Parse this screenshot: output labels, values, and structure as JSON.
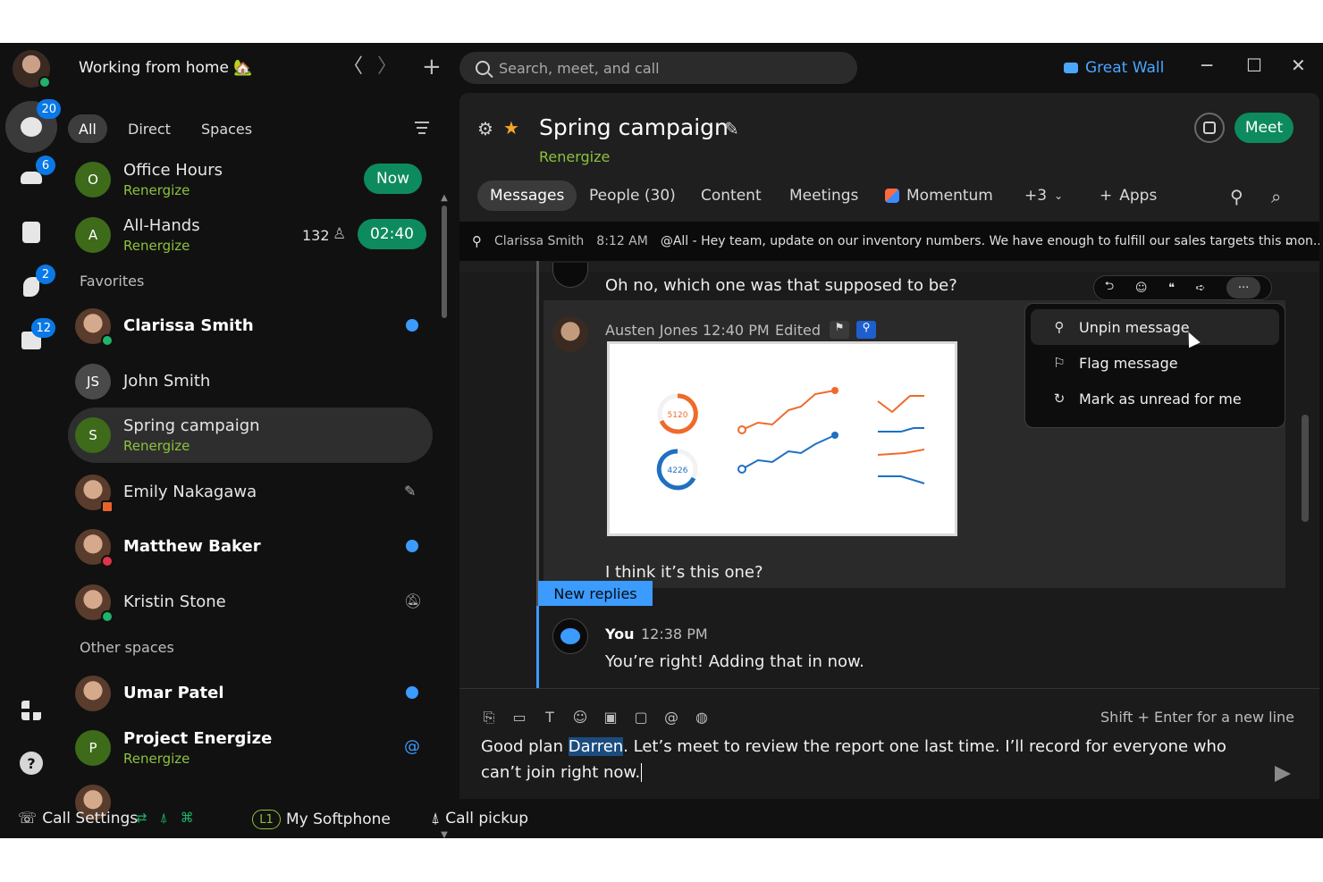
{
  "titlebar": {
    "status": "Working from home 🏡",
    "search_placeholder": "Search, meet, and call",
    "org_name": "Great Wall",
    "nav_back": "〈",
    "nav_forward": "〉",
    "new": "+",
    "minimize": "─",
    "maximize": "☐",
    "close": "✕"
  },
  "rail": {
    "messages_badge": "20",
    "teams_badge": "6",
    "calls_badge": "2",
    "calendar_badge": "12",
    "help": "?"
  },
  "filters": [
    "All",
    "Direct",
    "Spaces"
  ],
  "conversations": {
    "office_hours": {
      "initial": "O",
      "title": "Office Hours",
      "sub": "Renergize",
      "pill": "Now"
    },
    "all_hands": {
      "initial": "A",
      "title": "All-Hands",
      "sub": "Renergize",
      "count": "132",
      "pill": "02:40"
    },
    "favorites_label": "Favorites",
    "clarissa": {
      "title": "Clarissa Smith"
    },
    "john": {
      "initial": "JS",
      "title": "John Smith"
    },
    "spring": {
      "initial": "S",
      "title": "Spring campaign",
      "sub": "Renergize"
    },
    "emily": {
      "title": "Emily Nakagawa"
    },
    "matthew": {
      "title": "Matthew Baker"
    },
    "kristin": {
      "title": "Kristin Stone"
    },
    "other_label": "Other spaces",
    "umar": {
      "title": "Umar Patel"
    },
    "project": {
      "initial": "P",
      "title": "Project Energize",
      "sub": "Renergize"
    }
  },
  "space": {
    "title": "Spring campaign",
    "team": "Renergize",
    "meet_label": "Meet",
    "tabs": [
      "Messages",
      "People (30)",
      "Content",
      "Meetings",
      "Momentum",
      "+3",
      "Apps"
    ]
  },
  "pinned": {
    "author": "Clarissa Smith",
    "time": "8:12 AM",
    "text": "@All - Hey team, update on our inventory numbers. We have enough to fulfill our sales targets this mon..."
  },
  "messages": {
    "prev_text": "Oh no, which one was that supposed to be?",
    "austen_name": "Austen Jones",
    "austen_time": "12:40 PM",
    "austen_edited": "Edited",
    "chart_value_1": "5120",
    "chart_value_2": "4226",
    "austen_text": "I think it’s this one?",
    "new_replies": "New replies",
    "you_name": "You",
    "you_time": "12:38 PM",
    "you_text": "You’re right! Adding that in now."
  },
  "context_menu": {
    "unpin": "Unpin message",
    "flag": "Flag message",
    "unread": "Mark as unread for me"
  },
  "composer": {
    "hint": "Shift + Enter for a new line",
    "text_before": "Good plan ",
    "mention": "Darren",
    "text_after": ". Let’s meet to review the report one last time. I’ll record for everyone who can’t join right now."
  },
  "footer": {
    "call_settings": "Call Settings",
    "line": "L1",
    "softphone": "My Softphone",
    "pickup": "Call pickup"
  }
}
